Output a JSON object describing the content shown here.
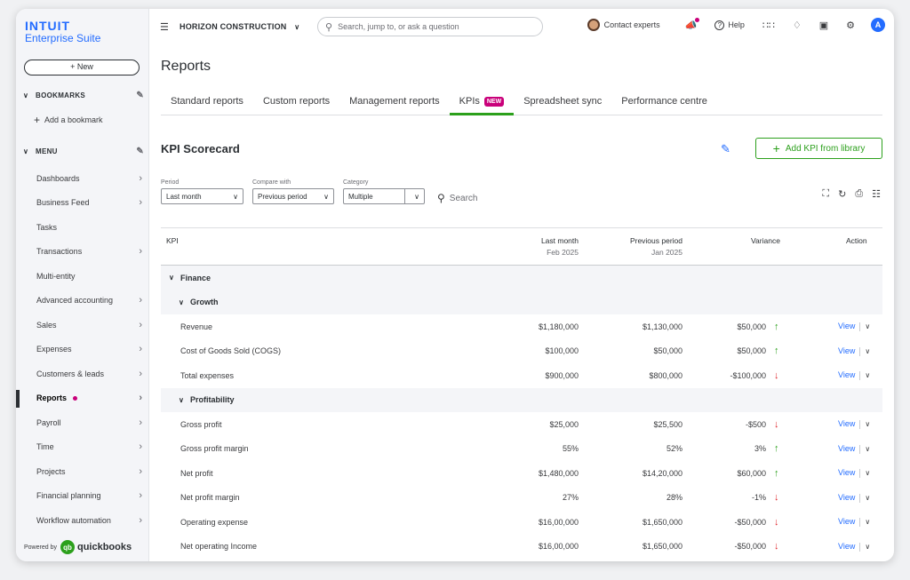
{
  "brand": {
    "line1": "INTUIT",
    "line2": "Enterprise Suite"
  },
  "sidebar": {
    "new_label": "New",
    "bookmarks_label": "BOOKMARKS",
    "add_bookmark": "Add a bookmark",
    "menu_label": "MENU",
    "items": [
      {
        "label": "Dashboards",
        "arrow": true
      },
      {
        "label": "Business Feed",
        "arrow": true
      },
      {
        "label": "Tasks",
        "arrow": false
      },
      {
        "label": "Transactions",
        "arrow": true
      },
      {
        "label": "Multi-entity",
        "arrow": false
      },
      {
        "label": "Advanced accounting",
        "arrow": true
      },
      {
        "label": "Sales",
        "arrow": true
      },
      {
        "label": "Expenses",
        "arrow": true
      },
      {
        "label": "Customers & leads",
        "arrow": true
      },
      {
        "label": "Reports",
        "arrow": true,
        "active": true
      },
      {
        "label": "Payroll",
        "arrow": true
      },
      {
        "label": "Time",
        "arrow": true
      },
      {
        "label": "Projects",
        "arrow": true
      },
      {
        "label": "Financial planning",
        "arrow": true
      },
      {
        "label": "Workflow automation",
        "arrow": true
      }
    ],
    "powered_by": "Powered by",
    "qb_brand": "quickbooks"
  },
  "topbar": {
    "company": "HORIZON CONSTRUCTION",
    "search_placeholder": "Search, jump to, or ask a question",
    "contact": "Contact experts",
    "help": "Help",
    "user_initial": "A"
  },
  "page": {
    "title": "Reports",
    "tabs": [
      "Standard reports",
      "Custom reports",
      "Management reports",
      "KPIs",
      "Spreadsheet sync",
      "Performance centre"
    ],
    "active_tab": 3,
    "new_badge": "NEW"
  },
  "scorecard": {
    "title": "KPI Scorecard",
    "add_button": "Add KPI from library",
    "filters": [
      {
        "label": "Period",
        "value": "Last month"
      },
      {
        "label": "Compare with",
        "value": "Previous period"
      },
      {
        "label": "Category",
        "value": "Multiple"
      }
    ],
    "search_label": "Search"
  },
  "table": {
    "headers": {
      "kpi": "KPI",
      "last_month": "Last month",
      "last_month_sub": "Feb 2025",
      "previous": "Previous period",
      "previous_sub": "Jan 2025",
      "variance": "Variance",
      "action": "Action"
    },
    "view_label": "View",
    "rows": [
      {
        "type": "group",
        "level": 0,
        "label": "Finance"
      },
      {
        "type": "group",
        "level": 1,
        "label": "Growth"
      },
      {
        "type": "data",
        "label": "Revenue",
        "last": "$1,180,000",
        "prev": "$1,130,000",
        "var": "$50,000",
        "dir": "up"
      },
      {
        "type": "data",
        "label": "Cost of Goods Sold (COGS)",
        "last": "$100,000",
        "prev": "$50,000",
        "var": "$50,000",
        "dir": "up"
      },
      {
        "type": "data",
        "label": "Total expenses",
        "last": "$900,000",
        "prev": "$800,000",
        "var": "-$100,000",
        "dir": "down"
      },
      {
        "type": "group",
        "level": 1,
        "label": "Profitability"
      },
      {
        "type": "data",
        "label": "Gross profit",
        "last": "$25,000",
        "prev": "$25,500",
        "var": "-$500",
        "dir": "down"
      },
      {
        "type": "data",
        "label": "Gross profit margin",
        "last": "55%",
        "prev": "52%",
        "var": "3%",
        "dir": "up"
      },
      {
        "type": "data",
        "label": "Net profit",
        "last": "$1,480,000",
        "prev": "$14,20,000",
        "var": "$60,000",
        "dir": "up"
      },
      {
        "type": "data",
        "label": "Net profit margin",
        "last": "27%",
        "prev": "28%",
        "var": "-1%",
        "dir": "down"
      },
      {
        "type": "data",
        "label": "Operating expense",
        "last": "$16,00,000",
        "prev": "$1,650,000",
        "var": "-$50,000",
        "dir": "down"
      },
      {
        "type": "data",
        "label": "Net operating Income",
        "last": "$16,00,000",
        "prev": "$1,650,000",
        "var": "-$50,000",
        "dir": "down"
      }
    ]
  },
  "colors": {
    "accent_green": "#2ca01c",
    "link_blue": "#236cff",
    "badge_pink": "#c9007a",
    "down_red": "#e0282e"
  }
}
